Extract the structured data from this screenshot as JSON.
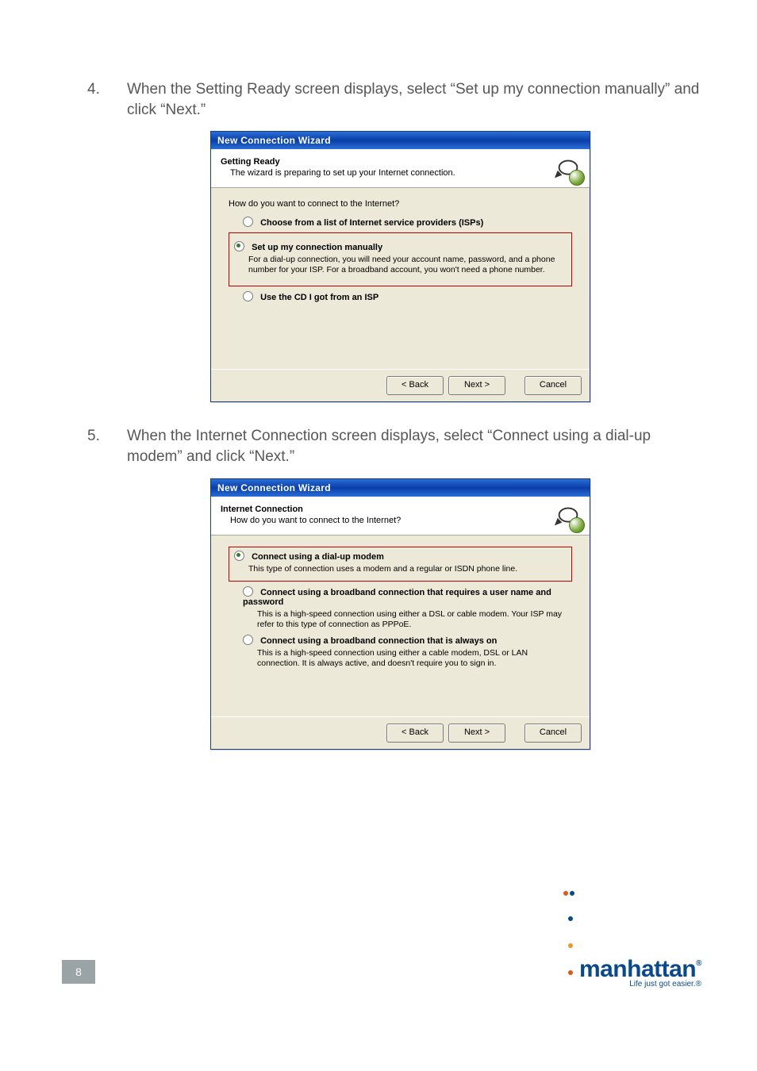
{
  "steps": {
    "s4": {
      "num": "4.",
      "text": "When the Setting Ready screen displays, select “Set up my connection manually” and click “Next.”"
    },
    "s5": {
      "num": "5.",
      "text": "When the Internet Connection screen displays, select “Connect using a dial-up modem” and click “Next.”"
    }
  },
  "dialog1": {
    "title": "New Connection Wizard",
    "header_title": "Getting Ready",
    "header_sub": "The wizard is preparing to set up your Internet connection.",
    "question": "How do you want to connect to the Internet?",
    "opt1": {
      "label": "Choose from a list of Internet service providers (ISPs)"
    },
    "opt2": {
      "label": "Set up my connection manually",
      "desc": "For a dial-up connection, you will need your account name, password, and a phone number for your ISP. For a broadband account, you won't need a phone number."
    },
    "opt3": {
      "label": "Use the CD I got from an ISP"
    },
    "buttons": {
      "back": "< Back",
      "next": "Next >",
      "cancel": "Cancel"
    }
  },
  "dialog2": {
    "title": "New Connection Wizard",
    "header_title": "Internet Connection",
    "header_sub": "How do you want to connect to the Internet?",
    "opt1": {
      "label": "Connect using a dial-up modem",
      "desc": "This type of connection uses a modem and a regular or ISDN phone line."
    },
    "opt2": {
      "label": "Connect using a broadband connection that requires a user name and password",
      "desc": "This is a high-speed connection using either a DSL or cable modem. Your ISP may refer to this type of connection as PPPoE."
    },
    "opt3": {
      "label": "Connect using a broadband connection that is always on",
      "desc": "This is a high-speed connection using either a cable modem, DSL or LAN connection. It is always active, and doesn't require you to sign in."
    },
    "buttons": {
      "back": "< Back",
      "next": "Next >",
      "cancel": "Cancel"
    }
  },
  "footer": {
    "page": "8",
    "brand": "manhattan",
    "tag": "Life just got easier.®"
  }
}
